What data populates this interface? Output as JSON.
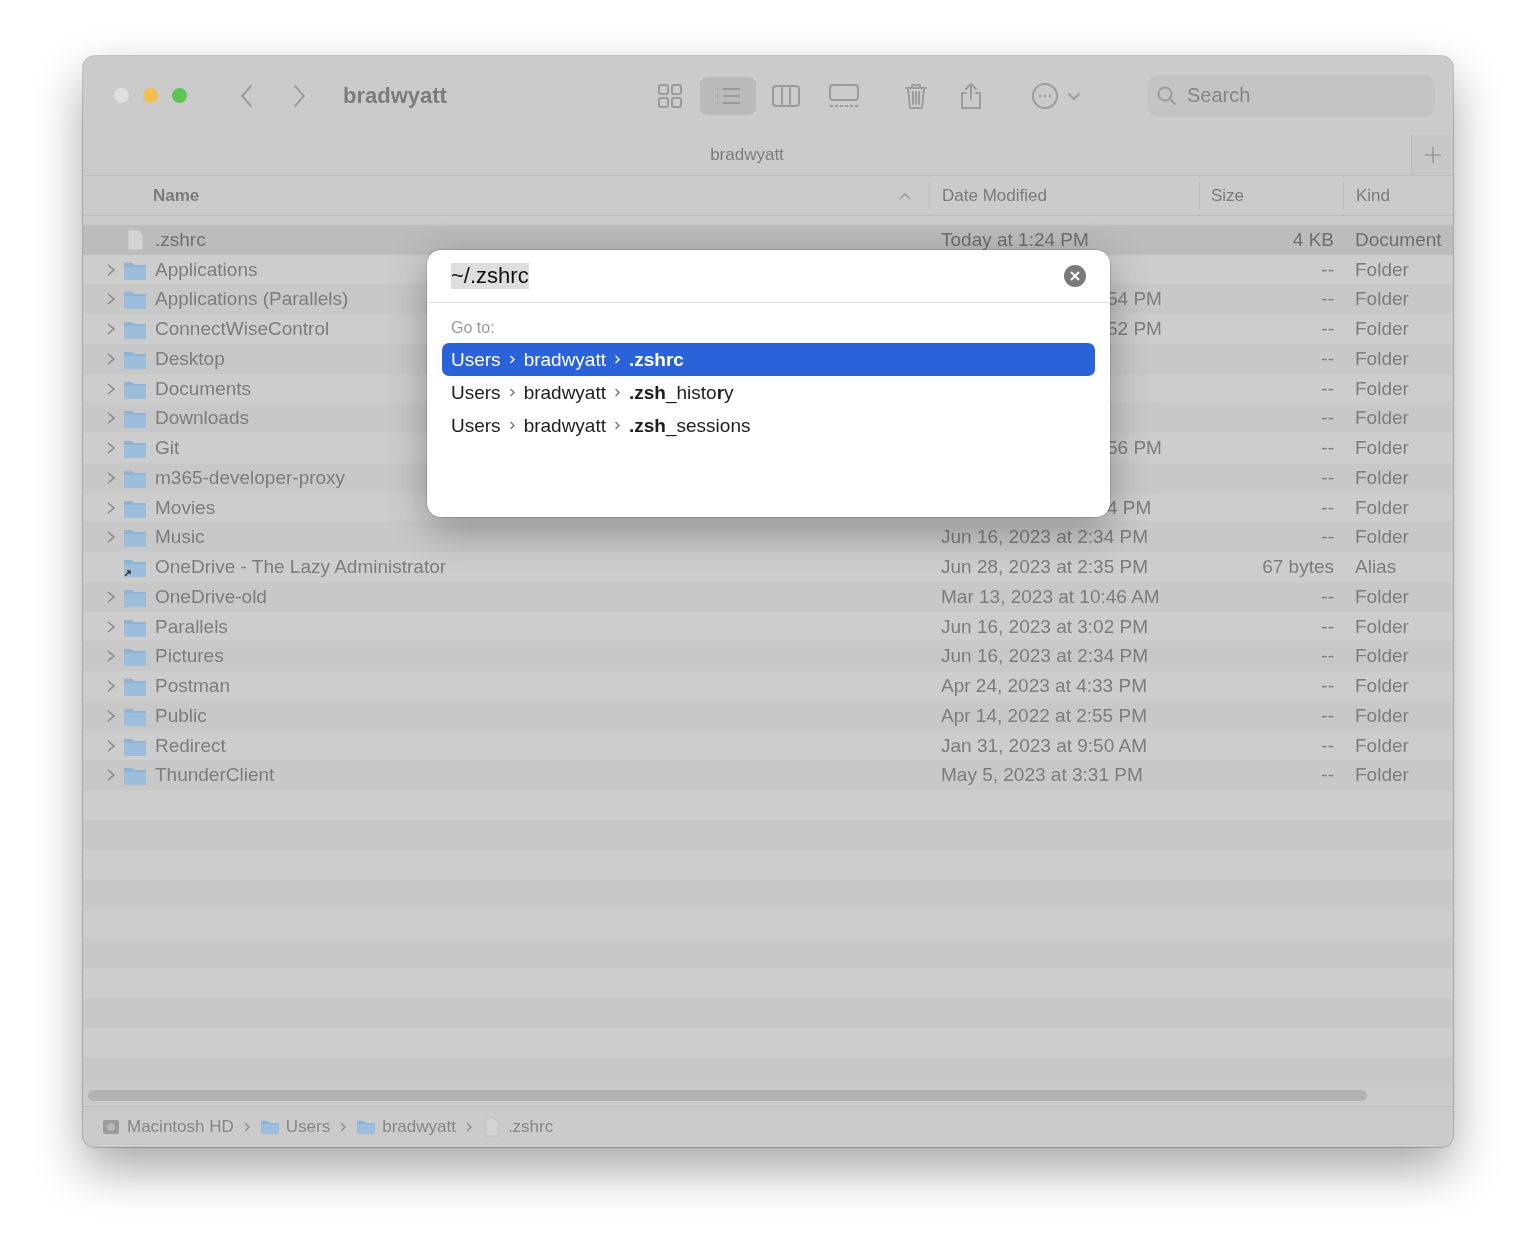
{
  "window": {
    "title": "bradwyatt"
  },
  "toolbar": {
    "views": [
      {
        "kind": "icons",
        "selected": false
      },
      {
        "kind": "list",
        "selected": true
      },
      {
        "kind": "columns",
        "selected": false
      },
      {
        "kind": "gallery",
        "selected": false
      }
    ],
    "search": {
      "placeholder": "Search"
    }
  },
  "tab": {
    "label": "bradwyatt"
  },
  "columns": [
    {
      "label": "Name",
      "sorted": true
    },
    {
      "label": "Date Modified",
      "sorted": false
    },
    {
      "label": "Size",
      "sorted": false
    },
    {
      "label": "Kind",
      "sorted": false
    }
  ],
  "rows": [
    {
      "name": ".zshrc",
      "kind": "file",
      "expandable": false,
      "selected": true,
      "date": "Today at 1:24 PM",
      "size": "4 KB",
      "kind_label": "Document"
    },
    {
      "name": "Applications",
      "kind": "folder",
      "expandable": true,
      "selected": false,
      "size": "--",
      "kind_label": "Folder"
    },
    {
      "name": "Applications (Parallels)",
      "kind": "folder",
      "expandable": true,
      "selected": false,
      "date": "54 PM",
      "date_clipped": true,
      "size": "--",
      "kind_label": "Folder"
    },
    {
      "name": "ConnectWiseControl",
      "kind": "folder",
      "expandable": true,
      "selected": false,
      "date": "52 PM",
      "date_clipped": true,
      "size": "--",
      "kind_label": "Folder"
    },
    {
      "name": "Desktop",
      "kind": "folder",
      "expandable": true,
      "selected": false,
      "size": "--",
      "kind_label": "Folder"
    },
    {
      "name": "Documents",
      "kind": "folder",
      "expandable": true,
      "selected": false,
      "size": "--",
      "kind_label": "Folder"
    },
    {
      "name": "Downloads",
      "kind": "folder",
      "expandable": true,
      "selected": false,
      "size": "--",
      "kind_label": "Folder"
    },
    {
      "name": "Git",
      "kind": "folder",
      "expandable": true,
      "selected": false,
      "date": "56 PM",
      "date_clipped": true,
      "size": "--",
      "kind_label": "Folder"
    },
    {
      "name": "m365-developer-proxy",
      "kind": "folder",
      "expandable": true,
      "selected": false,
      "size": "--",
      "kind_label": "Folder"
    },
    {
      "name": "Movies",
      "kind": "folder",
      "expandable": true,
      "selected": false,
      "date": "4 PM",
      "date_clipped": true,
      "size": "--",
      "kind_label": "Folder"
    },
    {
      "name": "Music",
      "kind": "folder",
      "expandable": true,
      "selected": false,
      "date": "Jun 16, 2023 at 2:34 PM",
      "size": "--",
      "kind_label": "Folder"
    },
    {
      "name": "OneDrive - The Lazy Administrator",
      "kind": "alias",
      "expandable": false,
      "selected": false,
      "date": "Jun 28, 2023 at 2:35 PM",
      "size": "67 bytes",
      "kind_label": "Alias"
    },
    {
      "name": "OneDrive-old",
      "kind": "folder",
      "expandable": true,
      "selected": false,
      "date": "Mar 13, 2023 at 10:46 AM",
      "size": "--",
      "kind_label": "Folder"
    },
    {
      "name": "Parallels",
      "kind": "folder",
      "expandable": true,
      "selected": false,
      "date": "Jun 16, 2023 at 3:02 PM",
      "size": "--",
      "kind_label": "Folder"
    },
    {
      "name": "Pictures",
      "kind": "folder",
      "expandable": true,
      "selected": false,
      "date": "Jun 16, 2023 at 2:34 PM",
      "size": "--",
      "kind_label": "Folder"
    },
    {
      "name": "Postman",
      "kind": "folder",
      "expandable": true,
      "selected": false,
      "date": "Apr 24, 2023 at 4:33 PM",
      "size": "--",
      "kind_label": "Folder"
    },
    {
      "name": "Public",
      "kind": "folder",
      "expandable": true,
      "selected": false,
      "date": "Apr 14, 2022 at 2:55 PM",
      "size": "--",
      "kind_label": "Folder"
    },
    {
      "name": "Redirect",
      "kind": "folder",
      "expandable": true,
      "selected": false,
      "date": "Jan 31, 2023 at 9:50 AM",
      "size": "--",
      "kind_label": "Folder"
    },
    {
      "name": "ThunderClient",
      "kind": "folder",
      "expandable": true,
      "selected": false,
      "date": "May 5, 2023 at 3:31 PM",
      "size": "--",
      "kind_label": "Folder"
    }
  ],
  "goto_dialog": {
    "value": "~/.zshrc",
    "heading": "Go to:",
    "suggestions": [
      {
        "path": [
          "Users",
          "bradwyatt",
          "**.zshrc**"
        ],
        "selected": true
      },
      {
        "path": [
          "Users",
          "bradwyatt",
          "**.zsh**_histo**r**y"
        ],
        "selected": false
      },
      {
        "path": [
          "Users",
          "bradwyatt",
          "**.zsh**_sessions"
        ],
        "selected": false
      }
    ]
  },
  "path_bar": [
    {
      "kind": "disk",
      "label": "Macintosh HD"
    },
    {
      "kind": "folder",
      "label": "Users"
    },
    {
      "kind": "folder",
      "label": "bradwyatt"
    },
    {
      "kind": "file",
      "label": ".zshrc"
    }
  ]
}
